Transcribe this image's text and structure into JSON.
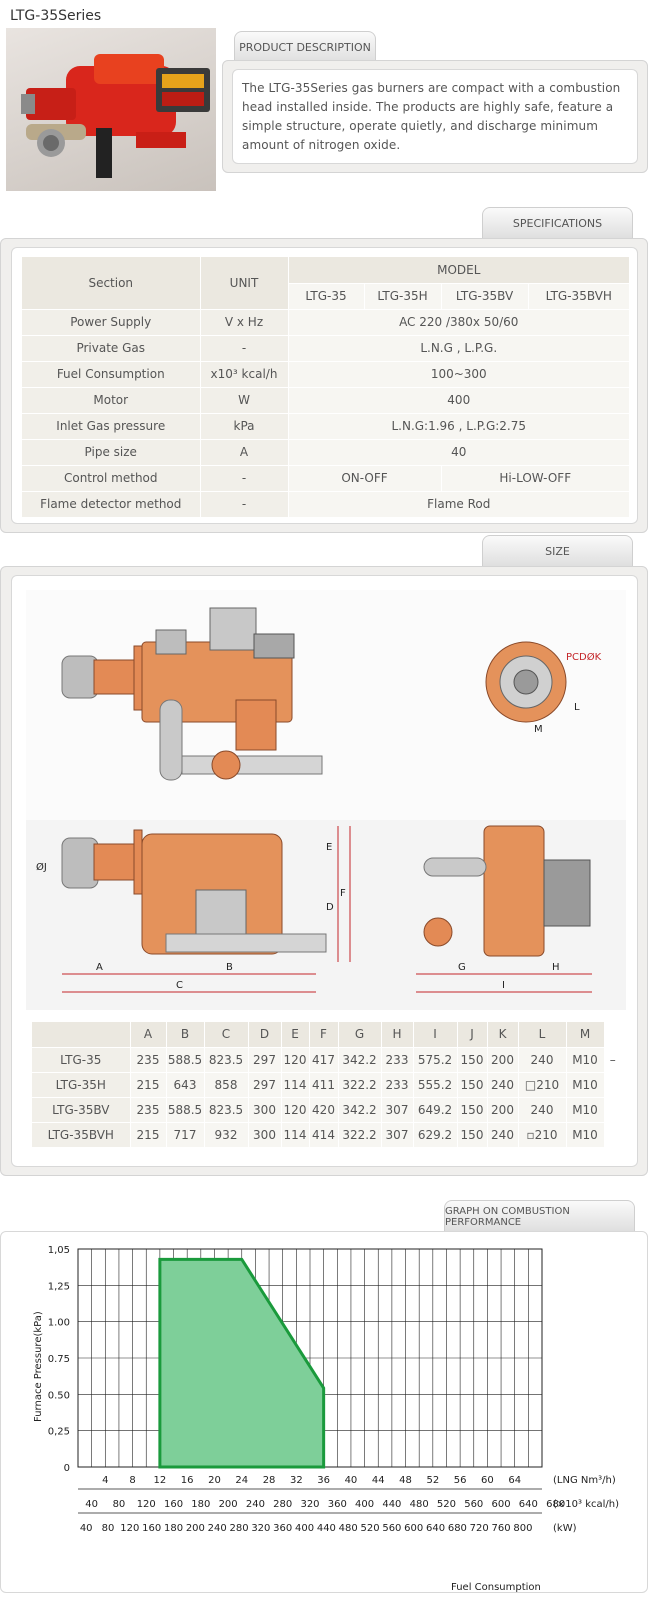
{
  "page_title": "LTG-35Series",
  "tabs": {
    "product_description": "PRODUCT DESCRIPTION",
    "specifications": "SPECIFICATIONS",
    "size": "SIZE",
    "graph": "GRAPH ON COMBUSTION PERFORMANCE"
  },
  "description": "The LTG-35Series gas burners are compact with a combustion head installed inside. The products are highly safe, feature a simple structure, operate quietly, and discharge minimum amount of nitrogen oxide.",
  "spec": {
    "header": {
      "section": "Section",
      "unit": "UNIT",
      "model": "MODEL",
      "models": [
        "LTG-35",
        "LTG-35H",
        "LTG-35BV",
        "LTG-35BVH"
      ]
    },
    "rows": [
      {
        "label": "Power Supply",
        "unit": "V x Hz",
        "value": "AC 220 /380x 50/60"
      },
      {
        "label": "Private Gas",
        "unit": "-",
        "value": "L.N.G , L.P.G."
      },
      {
        "label": "Fuel Consumption",
        "unit": "x10³ kcal/h",
        "value": "100~300"
      },
      {
        "label": "Motor",
        "unit": "W",
        "value": "400"
      },
      {
        "label": "Inlet Gas pressure",
        "unit": "kPa",
        "value": "L.N.G:1.96 , L.P.G:2.75"
      },
      {
        "label": "Pipe size",
        "unit": "A",
        "value": "40"
      },
      {
        "label": "Control method",
        "unit": "-",
        "value_a": "ON-OFF",
        "value_b": "Hi-LOW-OFF"
      },
      {
        "label": "Flame detector method",
        "unit": "-",
        "value": "Flame Rod"
      }
    ]
  },
  "drawing_labels": {
    "pcd": "PCDØK",
    "l": "L",
    "m": "M",
    "j": "ØJ",
    "e": "E",
    "f": "F",
    "d": "D",
    "a": "A",
    "b": "B",
    "c": "C",
    "g": "G",
    "h": "H",
    "i": "I"
  },
  "size_table": {
    "headers": [
      "",
      "A",
      "B",
      "C",
      "D",
      "E",
      "F",
      "G",
      "H",
      "I",
      "J",
      "K",
      "L",
      "M"
    ],
    "rows": [
      [
        "LTG-35",
        "235",
        "588.5",
        "823.5",
        "297",
        "120",
        "417",
        "342.2",
        "233",
        "575.2",
        "150",
        "200",
        "240",
        "M10"
      ],
      [
        "LTG-35H",
        "215",
        "643",
        "858",
        "297",
        "114",
        "411",
        "322.2",
        "233",
        "555.2",
        "150",
        "240",
        "□210",
        "M10"
      ],
      [
        "LTG-35BV",
        "235",
        "588.5",
        "823.5",
        "300",
        "120",
        "420",
        "342.2",
        "307",
        "649.2",
        "150",
        "200",
        "240",
        "M10"
      ],
      [
        "LTG-35BVH",
        "215",
        "717",
        "932",
        "300",
        "114",
        "414",
        "322.2",
        "307",
        "629.2",
        "150",
        "240",
        "▫210",
        "M10"
      ]
    ],
    "extra": "–"
  },
  "chart_data": {
    "type": "area",
    "ylabel": "Furnace Pressure(kPa)",
    "xlabel": "Fuel Consumption",
    "yticks": [
      "1,05",
      "1,25",
      "1.00",
      "0.75",
      "0.50",
      "0,25",
      "0"
    ],
    "x_lng": [
      "4",
      "8",
      "12",
      "16",
      "20",
      "24",
      "28",
      "32",
      "36",
      "40",
      "44",
      "48",
      "52",
      "56",
      "60",
      "64"
    ],
    "x_lng_label": "(LNG Nm³/h)",
    "x_kcal": [
      "40",
      "80",
      "120",
      "160",
      "180",
      "200",
      "240",
      "280",
      "320",
      "360",
      "400",
      "440",
      "480",
      "520",
      "560",
      "600",
      "640",
      "680"
    ],
    "x_kcal_label": "(×10³ kcal/h)",
    "x_kw": [
      "40",
      "80",
      "120",
      "160",
      "180",
      "200",
      "240",
      "280",
      "320",
      "360",
      "400",
      "440",
      "480",
      "520",
      "560",
      "600",
      "640",
      "680",
      "720",
      "760",
      "800"
    ],
    "x_kw_label": "(kW)",
    "series": [
      {
        "x": [
          120,
          120,
          240,
          360,
          360
        ],
        "y": [
          0,
          1.0,
          1.0,
          0.38,
          0
        ]
      }
    ],
    "ylim": [
      0,
      1.05
    ],
    "fill": "#7ecf99",
    "stroke": "#1a9a3c"
  }
}
